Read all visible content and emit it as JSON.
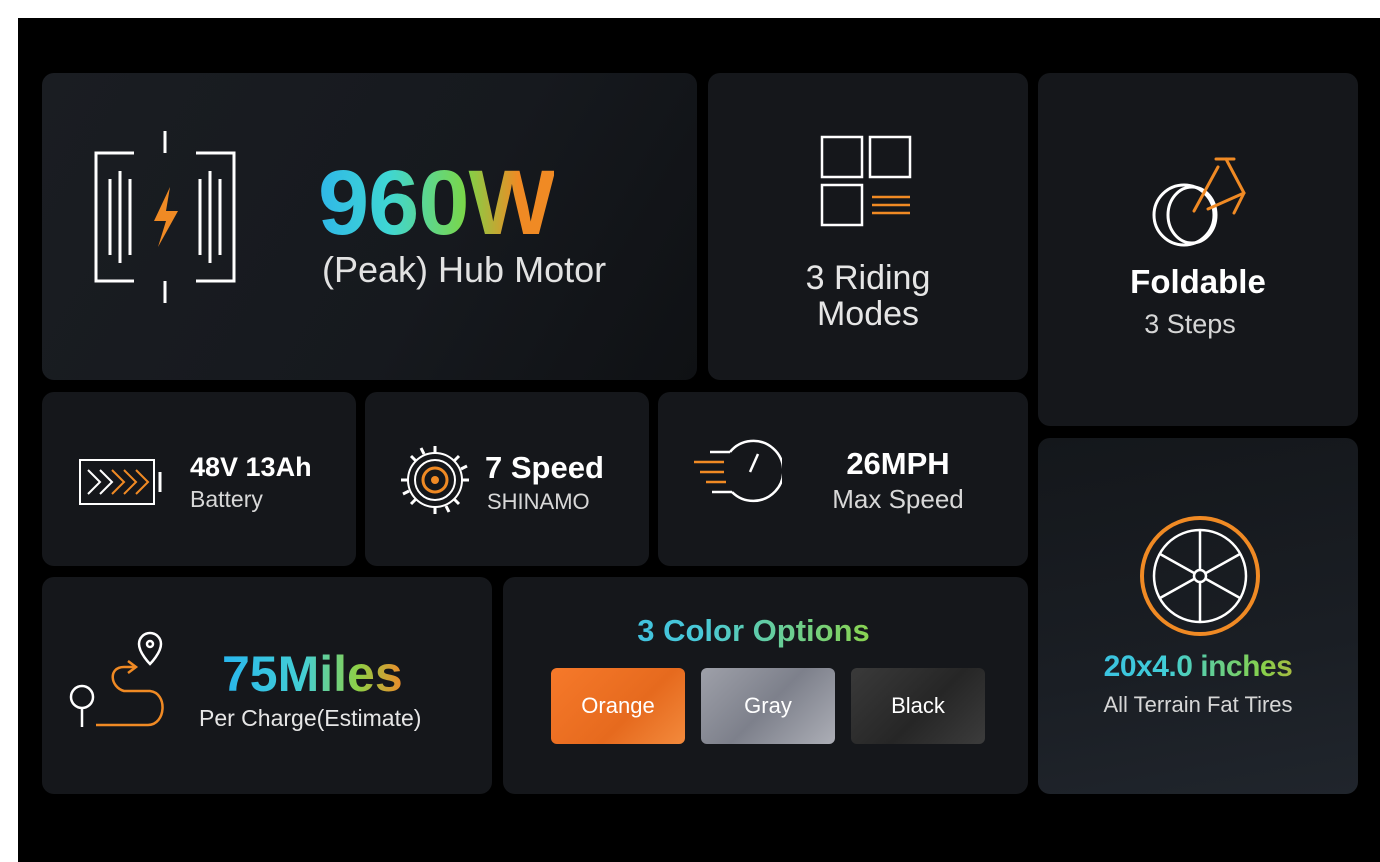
{
  "motor": {
    "value": "960W",
    "label": "(Peak) Hub Motor"
  },
  "modes": {
    "line1": "3 Riding",
    "line2": "Modes"
  },
  "fold": {
    "title": "Foldable",
    "sub": "3 Steps"
  },
  "battery": {
    "title": "48V 13Ah",
    "sub": "Battery"
  },
  "gears": {
    "title": "7 Speed",
    "sub": "SHINAMO"
  },
  "speed": {
    "title": "26MPH",
    "sub": "Max Speed"
  },
  "range": {
    "title": "75Miles",
    "sub": "Per Charge(Estimate)"
  },
  "colors": {
    "title": "3 Color Options",
    "options": [
      "Orange",
      "Gray",
      "Black"
    ]
  },
  "tires": {
    "title": "20x4.0 inches",
    "sub": "All Terrain Fat Tires"
  },
  "accent": "#f08a24",
  "icons": [
    "motor-icon",
    "riding-modes-icon",
    "folding-bike-icon",
    "battery-icon",
    "gear-icon",
    "speedometer-icon",
    "route-icon",
    "wheel-icon"
  ]
}
